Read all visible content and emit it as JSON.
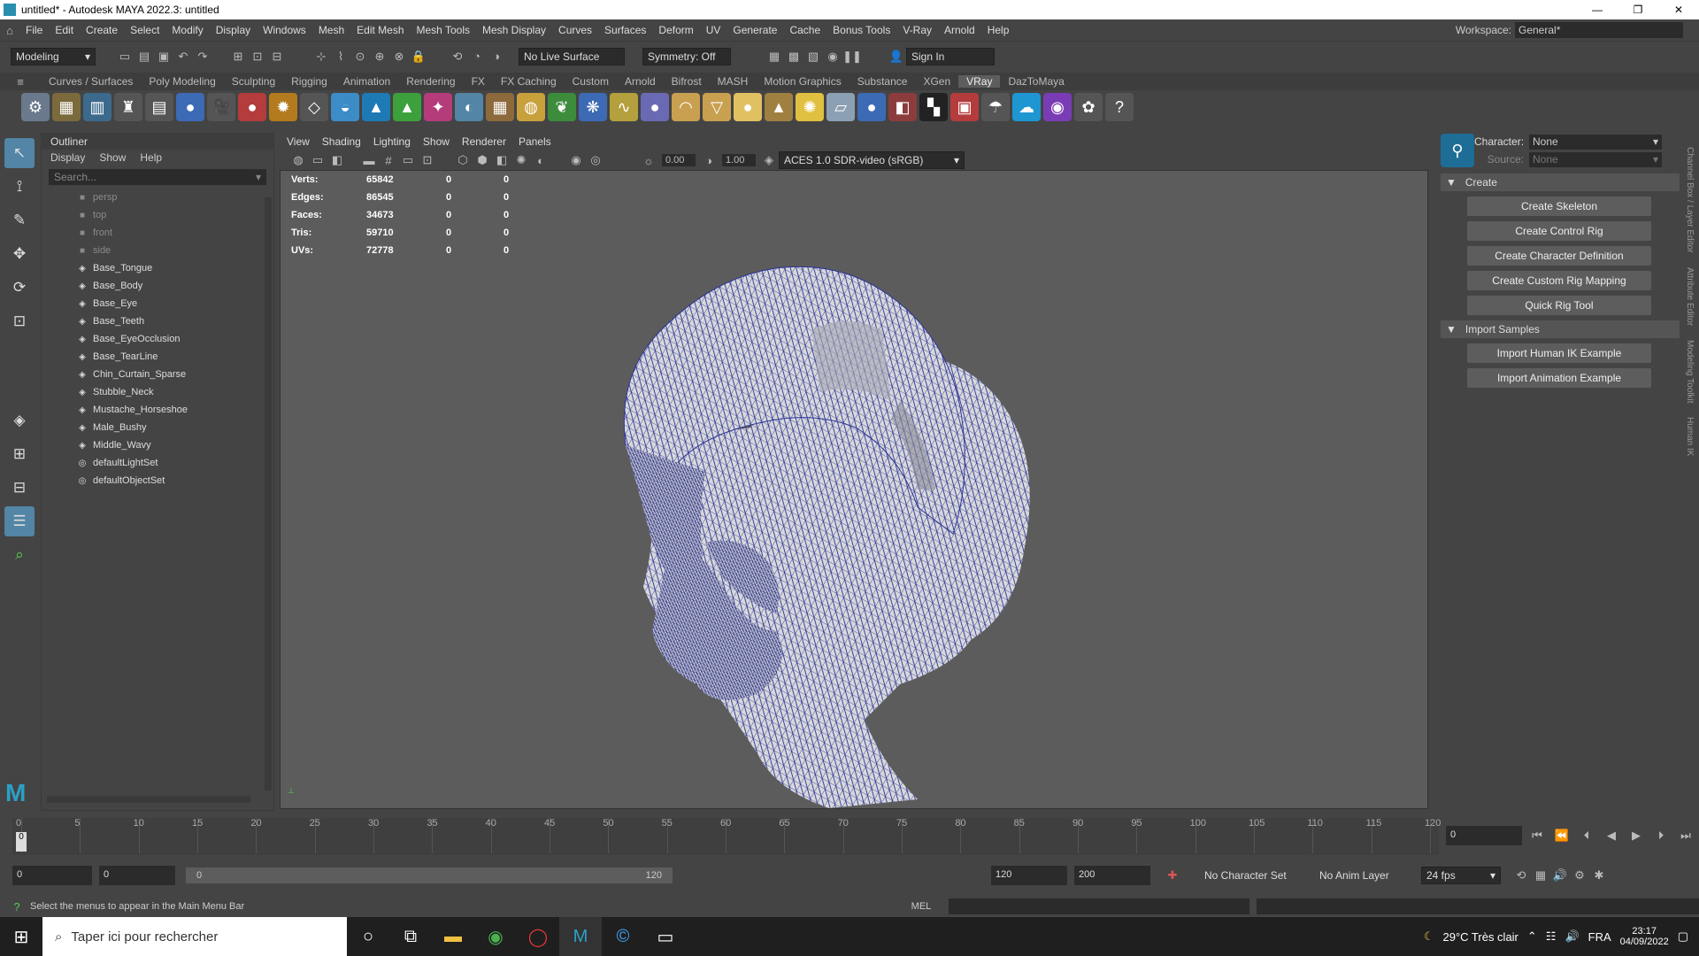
{
  "window": {
    "title": "untitled* - Autodesk MAYA 2022.3: untitled",
    "min": "—",
    "max": "❐",
    "close": "✕"
  },
  "menubar": {
    "items": [
      "File",
      "Edit",
      "Create",
      "Select",
      "Modify",
      "Display",
      "Windows",
      "Mesh",
      "Edit Mesh",
      "Mesh Tools",
      "Mesh Display",
      "Curves",
      "Surfaces",
      "Deform",
      "UV",
      "Generate",
      "Cache",
      "Bonus Tools",
      "V-Ray",
      "Arnold",
      "Help"
    ],
    "workspace_label": "Workspace:",
    "workspace_value": "General*"
  },
  "statusline": {
    "mode": "Modeling",
    "live_surface": "No Live Surface",
    "symmetry": "Symmetry: Off",
    "sign_in": "Sign In"
  },
  "shelf_tabs": [
    "Curves / Surfaces",
    "Poly Modeling",
    "Sculpting",
    "Rigging",
    "Animation",
    "Rendering",
    "FX",
    "FX Caching",
    "Custom",
    "Arnold",
    "Bifrost",
    "MASH",
    "Motion Graphics",
    "Substance",
    "XGen",
    "VRay",
    "DazToMaya"
  ],
  "shelf_active": "VRay",
  "outliner": {
    "title": "Outliner",
    "menu": [
      "Display",
      "Show",
      "Help"
    ],
    "search_placeholder": "Search...",
    "items": [
      {
        "label": "persp",
        "icon": "camera-icon",
        "dim": true
      },
      {
        "label": "top",
        "icon": "camera-icon",
        "dim": true
      },
      {
        "label": "front",
        "icon": "camera-icon",
        "dim": true
      },
      {
        "label": "side",
        "icon": "camera-icon",
        "dim": true
      },
      {
        "label": "Base_Tongue",
        "icon": "mesh-icon"
      },
      {
        "label": "Base_Body",
        "icon": "mesh-icon"
      },
      {
        "label": "Base_Eye",
        "icon": "mesh-icon"
      },
      {
        "label": "Base_Teeth",
        "icon": "mesh-icon"
      },
      {
        "label": "Base_EyeOcclusion",
        "icon": "mesh-icon"
      },
      {
        "label": "Base_TearLine",
        "icon": "mesh-icon"
      },
      {
        "label": "Chin_Curtain_Sparse",
        "icon": "mesh-icon"
      },
      {
        "label": "Stubble_Neck",
        "icon": "mesh-icon"
      },
      {
        "label": "Mustache_Horseshoe",
        "icon": "mesh-icon"
      },
      {
        "label": "Male_Bushy",
        "icon": "mesh-icon"
      },
      {
        "label": "Middle_Wavy",
        "icon": "mesh-icon"
      },
      {
        "label": "defaultLightSet",
        "icon": "set-icon"
      },
      {
        "label": "defaultObjectSet",
        "icon": "set-icon"
      }
    ]
  },
  "viewport": {
    "menu": [
      "View",
      "Shading",
      "Lighting",
      "Show",
      "Renderer",
      "Panels"
    ],
    "exposure": "0.00",
    "gamma": "1.00",
    "colorspace": "ACES 1.0 SDR-video (sRGB)",
    "hud": [
      {
        "label": "Verts:",
        "a": "65842",
        "b": "0",
        "c": "0"
      },
      {
        "label": "Edges:",
        "a": "86545",
        "b": "0",
        "c": "0"
      },
      {
        "label": "Faces:",
        "a": "34673",
        "b": "0",
        "c": "0"
      },
      {
        "label": "Tris:",
        "a": "59710",
        "b": "0",
        "c": "0"
      },
      {
        "label": "UVs:",
        "a": "72778",
        "b": "0",
        "c": "0"
      }
    ]
  },
  "hik": {
    "character_label": "Character:",
    "character_value": "None",
    "source_label": "Source:",
    "source_value": "None",
    "create_header": "Create",
    "create_buttons": [
      "Create Skeleton",
      "Create Control Rig",
      "Create Character Definition",
      "Create Custom Rig Mapping",
      "Quick Rig Tool"
    ],
    "import_header": "Import Samples",
    "import_buttons": [
      "Import Human IK Example",
      "Import Animation Example"
    ]
  },
  "right_tabs": [
    "Channel Box / Layer Editor",
    "Attribute Editor",
    "Modeling Toolkit",
    "Human IK"
  ],
  "timeline": {
    "ticks": [
      "0",
      "5",
      "10",
      "15",
      "20",
      "25",
      "30",
      "35",
      "40",
      "45",
      "50",
      "55",
      "60",
      "65",
      "70",
      "75",
      "80",
      "85",
      "90",
      "95",
      "100",
      "105",
      "110",
      "115",
      "120"
    ],
    "current_frame": "0"
  },
  "range": {
    "start": "0",
    "start2": "0",
    "slider_start": "0",
    "slider_end": "120",
    "end": "120",
    "end2": "200",
    "character_set": "No Character Set",
    "anim_layer": "No Anim Layer",
    "fps": "24 fps"
  },
  "cmdline": {
    "help": "Select the menus to appear in the Main Menu Bar",
    "lang": "MEL"
  },
  "taskbar": {
    "search": "Taper ici pour rechercher",
    "weather": "29°C  Très clair",
    "lang": "FRA",
    "time": "23:17",
    "date": "04/09/2022"
  }
}
